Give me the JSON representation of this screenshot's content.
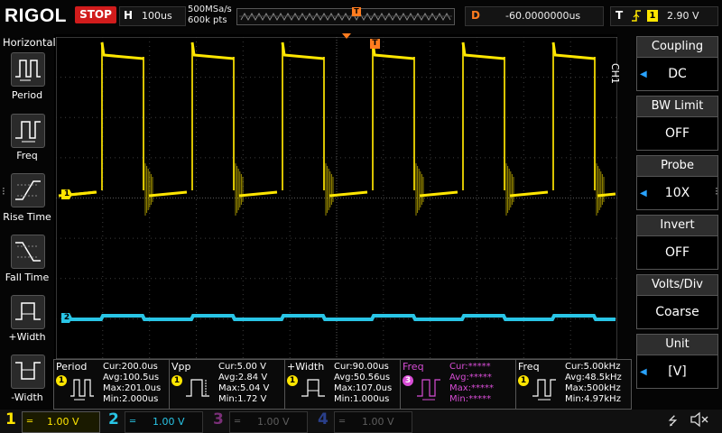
{
  "header": {
    "brand": "RIGOL",
    "run_state": "STOP",
    "horizontal_letter": "H",
    "timebase": "100us",
    "sample_rate": "500MSa/s",
    "memory_depth": "600k pts",
    "trigger_pos_marker": "T",
    "delay_letter": "D",
    "delay_value": "-60.0000000us",
    "trigger_letter": "T",
    "trigger_source": "1",
    "trigger_level": "2.90 V"
  },
  "sidebar": {
    "title": "Horizontal",
    "items": [
      {
        "label": "Period",
        "icon": "period-icon"
      },
      {
        "label": "Freq",
        "icon": "frequency-icon"
      },
      {
        "label": "Rise Time",
        "icon": "rise-time-icon"
      },
      {
        "label": "Fall Time",
        "icon": "fall-time-icon"
      },
      {
        "label": "+Width",
        "icon": "positive-width-icon"
      },
      {
        "label": "-Width",
        "icon": "negative-width-icon"
      }
    ]
  },
  "grid": {
    "ch1_marker": "1",
    "ch2_marker": "2",
    "trigger_marker": "T"
  },
  "right_panel": {
    "channel_label": "CH1",
    "menus": [
      {
        "title": "Coupling",
        "value": "DC",
        "has_arrow": true
      },
      {
        "title": "BW Limit",
        "value": "OFF",
        "has_arrow": false
      },
      {
        "title": "Probe",
        "value": "10X",
        "has_arrow": true
      },
      {
        "title": "Invert",
        "value": "OFF",
        "has_arrow": false
      },
      {
        "title": "Volts/Div",
        "value": "Coarse",
        "has_arrow": false
      },
      {
        "title": "Unit",
        "value": "[V]",
        "has_arrow": true
      }
    ]
  },
  "measurements": [
    {
      "name": "Period",
      "source": "1",
      "color": "#ffe600",
      "name_color": "#ffffff",
      "cur": "Cur:200.0us",
      "avg": "Avg:100.5us",
      "max": "Max:201.0us",
      "min": "Min:2.000us"
    },
    {
      "name": "Vpp",
      "source": "1",
      "color": "#ffe600",
      "name_color": "#ffffff",
      "cur": "Cur:5.00 V",
      "avg": "Avg:2.84 V",
      "max": "Max:5.04 V",
      "min": "Min:1.72 V"
    },
    {
      "name": "+Width",
      "source": "1",
      "color": "#ffe600",
      "name_color": "#ffffff",
      "cur": "Cur:90.00us",
      "avg": "Avg:50.56us",
      "max": "Max:107.0us",
      "min": "Min:1.000us"
    },
    {
      "name": "Freq",
      "source": "3",
      "color": "#d84dd6",
      "name_color": "#d84dd6",
      "cur": "Cur:*****",
      "avg": "Avg:*****",
      "max": "Max:*****",
      "min": "Min:*****"
    },
    {
      "name": "Freq",
      "source": "1",
      "color": "#ffe600",
      "name_color": "#ffffff",
      "cur": "Cur:5.00kHz",
      "avg": "Avg:48.5kHz",
      "max": "Max:500kHz",
      "min": "Min:4.97kHz"
    }
  ],
  "channels": [
    {
      "num": "1",
      "scale": "1.00 V",
      "color": "#ffe600",
      "active": true
    },
    {
      "num": "2",
      "scale": "1.00 V",
      "color": "#29c5e6",
      "active": true
    },
    {
      "num": "3",
      "scale": "1.00 V",
      "color": "#7a2f78",
      "active": false
    },
    {
      "num": "4",
      "scale": "1.00 V",
      "color": "#2a3f8a",
      "active": false
    }
  ],
  "colors": {
    "ch1": "#ffe600",
    "ch2": "#29c5e6",
    "trigger": "#ff7c1f",
    "menu_arrow": "#29a3ff"
  }
}
